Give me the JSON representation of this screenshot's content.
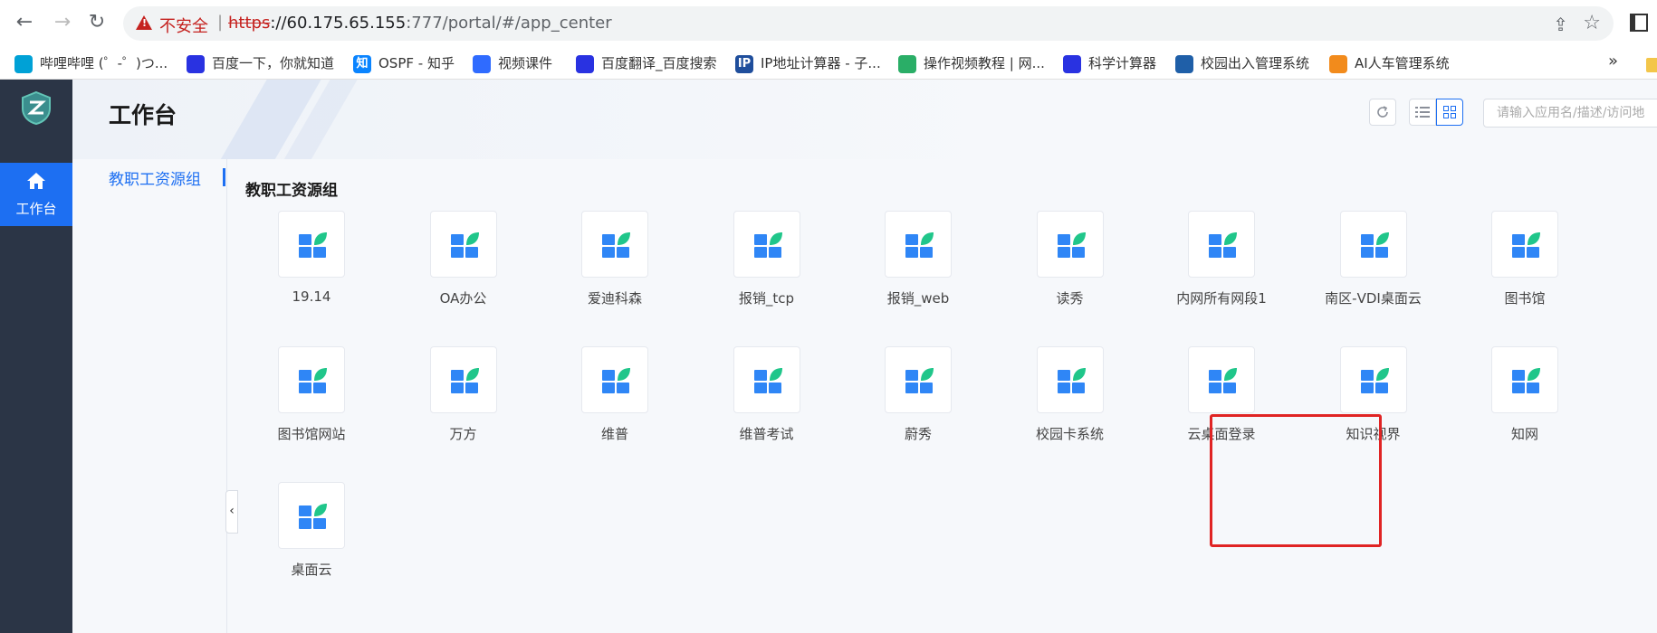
{
  "browser": {
    "security_label": "不安全",
    "separator": "|",
    "url_scheme": "https",
    "url_host": "://60.175.65.155",
    "url_rest": ":777/portal/#/app_center"
  },
  "bookmarks": [
    {
      "label": "哔哩哔哩 (゜-゜)つ...",
      "icon": "bilibili-icon",
      "color": "#00a1d6"
    },
    {
      "label": "百度一下，你就知道",
      "icon": "baidu-paw-icon",
      "color": "#2932e1"
    },
    {
      "label": "OSPF - 知乎",
      "icon": "zhihu-icon",
      "color": "#0a84ff",
      "glyph": "知"
    },
    {
      "label": "视频课件",
      "icon": "baidu-cloud-icon",
      "color": "#2f6bff"
    },
    {
      "label": "百度翻译_百度搜索",
      "icon": "baidu-paw-icon",
      "color": "#2932e1"
    },
    {
      "label": "IP地址计算器 - 子...",
      "icon": "ip-calculator-icon",
      "color": "#1f4e9c",
      "glyph": "IP"
    },
    {
      "label": "操作视频教程 | 网...",
      "icon": "wechat-icon",
      "color": "#2aae67"
    },
    {
      "label": "科学计算器",
      "icon": "baidu-paw-icon",
      "color": "#2932e1"
    },
    {
      "label": "校园出入管理系统",
      "icon": "campus-logo-icon",
      "color": "#1f5fa8"
    },
    {
      "label": "AI人车管理系统",
      "icon": "ai-cloud-icon",
      "color": "#f28b1c"
    }
  ],
  "bookmarks_more": "»",
  "sidebar": {
    "active_item_label": "工作台"
  },
  "header": {
    "title": "工作台",
    "refresh_icon": "refresh-icon",
    "search_placeholder": "请输入应用名/描述/访问地"
  },
  "group_nav": {
    "label": "教职工资源组"
  },
  "section": {
    "title": "教职工资源组",
    "apps": [
      {
        "label": "19.14"
      },
      {
        "label": "OA办公"
      },
      {
        "label": "爱迪科森"
      },
      {
        "label": "报销_tcp"
      },
      {
        "label": "报销_web"
      },
      {
        "label": "读秀"
      },
      {
        "label": "内网所有网段1"
      },
      {
        "label": "南区-VDI桌面云"
      },
      {
        "label": "图书馆"
      },
      {
        "label": "图书馆网站"
      },
      {
        "label": "万方"
      },
      {
        "label": "维普"
      },
      {
        "label": "维普考试"
      },
      {
        "label": "蔚秀"
      },
      {
        "label": "校园卡系统"
      },
      {
        "label": "云桌面登录",
        "highlighted": true
      },
      {
        "label": "知识视界"
      },
      {
        "label": "知网"
      },
      {
        "label": "桌面云"
      }
    ]
  },
  "colors": {
    "accent": "#1d6ff2",
    "sidebar_bg": "#2b3546",
    "highlight_border": "#e02424",
    "app_icon_blue": "#2f86f6",
    "app_icon_green": "#20c68a"
  }
}
